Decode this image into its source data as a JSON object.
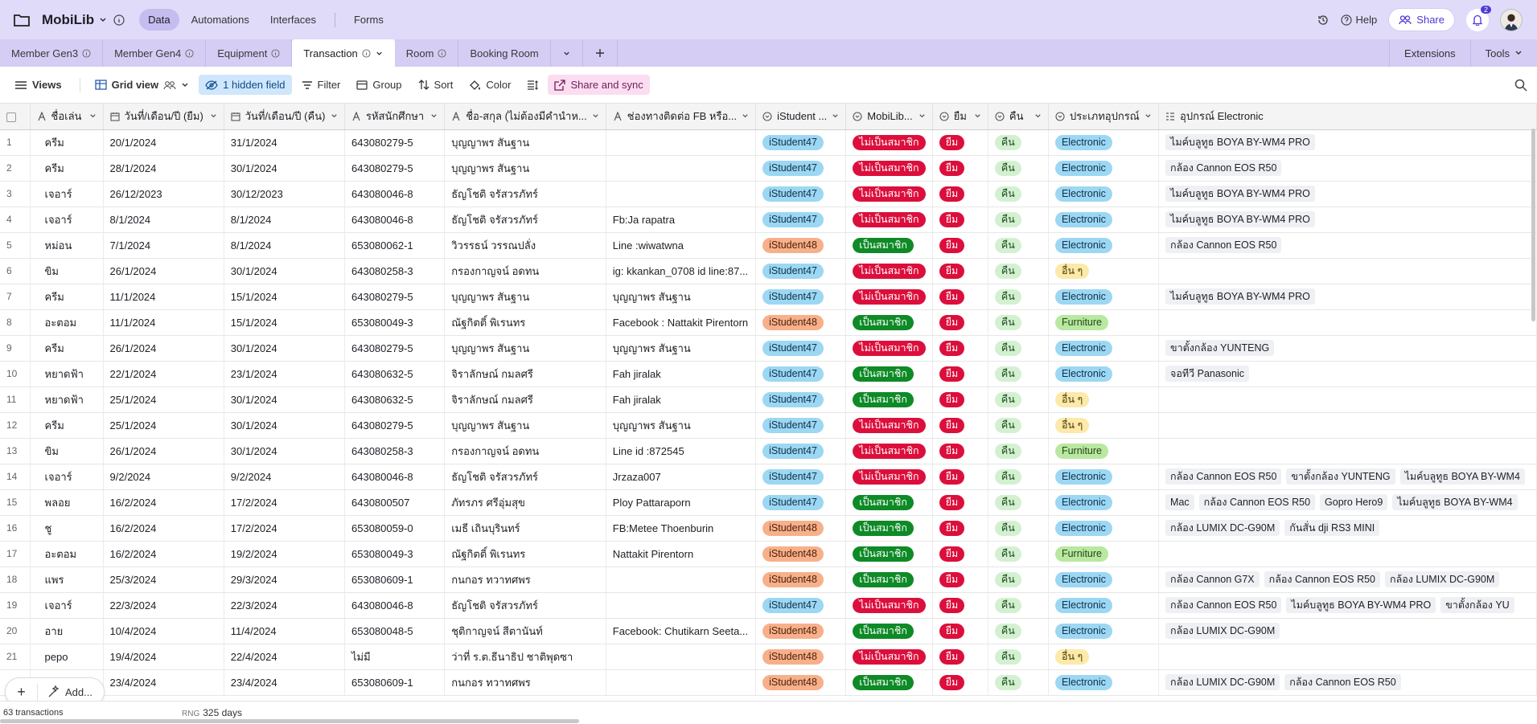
{
  "app": {
    "base_name": "MobiLib"
  },
  "nav": {
    "tabs": [
      {
        "label": "Data"
      },
      {
        "label": "Automations"
      },
      {
        "label": "Interfaces"
      },
      {
        "label": "Forms"
      }
    ]
  },
  "topright": {
    "help_label": "Help",
    "share_label": "Share",
    "notification_count": "2"
  },
  "tables": [
    {
      "label": "Member Gen3"
    },
    {
      "label": "Member Gen4"
    },
    {
      "label": "Equipment"
    },
    {
      "label": "Transaction"
    },
    {
      "label": "Room"
    },
    {
      "label": "Booking Room"
    }
  ],
  "tablebar_right": {
    "extensions": "Extensions",
    "tools": "Tools"
  },
  "toolbar": {
    "views": "Views",
    "grid_view": "Grid view",
    "hidden_field": "1 hidden field",
    "filter": "Filter",
    "group": "Group",
    "sort": "Sort",
    "color": "Color",
    "share_sync": "Share and sync"
  },
  "columns": [
    "ชื่อเล่น",
    "วันที่/เดือน/ปี (ยืม)",
    "วันที่/เดือน/ปี (คืน)",
    "รหัสนักศึกษา",
    "ชื่อ-สกุล (ไม่ต้องมีคำนำห...",
    "ช่องทางติดต่อ FB หรือ...",
    "iStudent ...",
    "MobiLib...",
    "ยืม",
    "คืน",
    "ประเภทอุปกรณ์",
    "อุปกรณ์ Electronic"
  ],
  "rows": [
    {
      "n": "1",
      "nick": "ครีม",
      "borrow": "20/1/2024",
      "ret": "31/1/2024",
      "sid": "643080279-5",
      "name": "บุญญาพร สันฐาน",
      "contact": "",
      "ist": "iStudent47",
      "mem": "ไม่เป็นสมาชิก",
      "b": "ยืม",
      "r": "คืน",
      "type": "Electronic",
      "items": [
        "ไมค์บลูทูธ BOYA BY-WM4 PRO"
      ]
    },
    {
      "n": "2",
      "nick": "ครีม",
      "borrow": "28/1/2024",
      "ret": "30/1/2024",
      "sid": "643080279-5",
      "name": "บุญญาพร สันฐาน",
      "contact": "",
      "ist": "iStudent47",
      "mem": "ไม่เป็นสมาชิก",
      "b": "ยืม",
      "r": "คืน",
      "type": "Electronic",
      "items": [
        "กล้อง Cannon EOS R50"
      ]
    },
    {
      "n": "3",
      "nick": "เจอาร์",
      "borrow": "26/12/2023",
      "ret": "30/12/2023",
      "sid": "643080046-8",
      "name": "ธัญโชติ จรัสวรภัทร์",
      "contact": "",
      "ist": "iStudent47",
      "mem": "ไม่เป็นสมาชิก",
      "b": "ยืม",
      "r": "คืน",
      "type": "Electronic",
      "items": [
        "ไมค์บลูทูธ BOYA BY-WM4 PRO"
      ]
    },
    {
      "n": "4",
      "nick": "เจอาร์",
      "borrow": "8/1/2024",
      "ret": "8/1/2024",
      "sid": "643080046-8",
      "name": "ธัญโชติ จรัสวรภัทร์",
      "contact": "Fb:Ja rapatra",
      "ist": "iStudent47",
      "mem": "ไม่เป็นสมาชิก",
      "b": "ยืม",
      "r": "คืน",
      "type": "Electronic",
      "items": [
        "ไมค์บลูทูธ BOYA BY-WM4 PRO"
      ]
    },
    {
      "n": "5",
      "nick": "หม่อน",
      "borrow": "7/1/2024",
      "ret": "8/1/2024",
      "sid": "653080062-1",
      "name": "วิวรรธน์ วรรณปลั่ง",
      "contact": "Line :wiwatwna",
      "ist": "iStudent48",
      "mem": "เป็นสมาชิก",
      "b": "ยืม",
      "r": "คืน",
      "type": "Electronic",
      "items": [
        "กล้อง Cannon EOS R50"
      ]
    },
    {
      "n": "6",
      "nick": "ขิม",
      "borrow": "26/1/2024",
      "ret": "30/1/2024",
      "sid": "643080258-3",
      "name": "กรองกาญจน์ อดทน",
      "contact": "ig: kkankan_0708 id line:87...",
      "ist": "iStudent47",
      "mem": "ไม่เป็นสมาชิก",
      "b": "ยืม",
      "r": "คืน",
      "type": "อื่น ๆ",
      "items": []
    },
    {
      "n": "7",
      "nick": "ครีม",
      "borrow": "11/1/2024",
      "ret": "15/1/2024",
      "sid": "643080279-5",
      "name": "บุญญาพร สันฐาน",
      "contact": "บุญญาพร สันฐาน",
      "ist": "iStudent47",
      "mem": "ไม่เป็นสมาชิก",
      "b": "ยืม",
      "r": "คืน",
      "type": "Electronic",
      "items": [
        "ไมค์บลูทูธ BOYA BY-WM4 PRO"
      ]
    },
    {
      "n": "8",
      "nick": "อะตอม",
      "borrow": "11/1/2024",
      "ret": "15/1/2024",
      "sid": "653080049-3",
      "name": "ณัฐกิตติ์ พิเรนทร",
      "contact": "Facebook : Nattakit Pirentorn",
      "ist": "iStudent48",
      "mem": "เป็นสมาชิก",
      "b": "ยืม",
      "r": "คืน",
      "type": "Furniture",
      "items": []
    },
    {
      "n": "9",
      "nick": "ครีม",
      "borrow": "26/1/2024",
      "ret": "30/1/2024",
      "sid": "643080279-5",
      "name": "บุญญาพร สันฐาน",
      "contact": "บุญญาพร สันฐาน",
      "ist": "iStudent47",
      "mem": "ไม่เป็นสมาชิก",
      "b": "ยืม",
      "r": "คืน",
      "type": "Electronic",
      "items": [
        "ขาตั้งกล้อง YUNTENG"
      ]
    },
    {
      "n": "10",
      "nick": "หยาดฟ้า",
      "borrow": "22/1/2024",
      "ret": "23/1/2024",
      "sid": "643080632-5",
      "name": "จิราลักษณ์ กมลศรี",
      "contact": "Fah jiralak",
      "ist": "iStudent47",
      "mem": "เป็นสมาชิก",
      "b": "ยืม",
      "r": "คืน",
      "type": "Electronic",
      "items": [
        "จอทีวี Panasonic"
      ]
    },
    {
      "n": "11",
      "nick": "หยาดฟ้า",
      "borrow": "25/1/2024",
      "ret": "30/1/2024",
      "sid": "643080632-5",
      "name": "จิราลักษณ์ กมลศรี",
      "contact": "Fah jiralak",
      "ist": "iStudent47",
      "mem": "เป็นสมาชิก",
      "b": "ยืม",
      "r": "คืน",
      "type": "อื่น ๆ",
      "items": []
    },
    {
      "n": "12",
      "nick": "ครีม",
      "borrow": "25/1/2024",
      "ret": "30/1/2024",
      "sid": "643080279-5",
      "name": "บุญญาพร สันฐาน",
      "contact": "บุญญาพร สันฐาน",
      "ist": "iStudent47",
      "mem": "ไม่เป็นสมาชิก",
      "b": "ยืม",
      "r": "คืน",
      "type": "อื่น ๆ",
      "items": []
    },
    {
      "n": "13",
      "nick": "ขิม",
      "borrow": "26/1/2024",
      "ret": "30/1/2024",
      "sid": "643080258-3",
      "name": "กรองกาญจน์ อดทน",
      "contact": "Line id :872545",
      "ist": "iStudent47",
      "mem": "ไม่เป็นสมาชิก",
      "b": "ยืม",
      "r": "คืน",
      "type": "Furniture",
      "items": []
    },
    {
      "n": "14",
      "nick": "เจอาร์",
      "borrow": "9/2/2024",
      "ret": "9/2/2024",
      "sid": "643080046-8",
      "name": "ธัญโชติ จรัสวรภัทร์",
      "contact": "Jrzaza007",
      "ist": "iStudent47",
      "mem": "ไม่เป็นสมาชิก",
      "b": "ยืม",
      "r": "คืน",
      "type": "Electronic",
      "items": [
        "กล้อง Cannon EOS R50",
        "ขาตั้งกล้อง YUNTENG",
        "ไมค์บลูทูธ BOYA BY-WM4"
      ]
    },
    {
      "n": "15",
      "nick": "พลอย",
      "borrow": "16/2/2024",
      "ret": "17/2/2024",
      "sid": "6430800507",
      "name": "ภัทรภร ศรีอุ่มสุข",
      "contact": "Ploy Pattaraporn",
      "ist": "iStudent47",
      "mem": "เป็นสมาชิก",
      "b": "ยืม",
      "r": "คืน",
      "type": "Electronic",
      "items": [
        "Mac",
        "กล้อง Cannon EOS R50",
        "Gopro Hero9",
        "ไมค์บลูทูธ BOYA BY-WM4"
      ]
    },
    {
      "n": "16",
      "nick": "ชู",
      "borrow": "16/2/2024",
      "ret": "17/2/2024",
      "sid": "653080059-0",
      "name": "เมธี เถินบุรินทร์",
      "contact": "FB:Metee Thoenburin",
      "ist": "iStudent48",
      "mem": "เป็นสมาชิก",
      "b": "ยืม",
      "r": "คืน",
      "type": "Electronic",
      "items": [
        "กล้อง LUMIX DC-G90M",
        "กันสั่น dji RS3 MINI"
      ]
    },
    {
      "n": "17",
      "nick": "อะตอม",
      "borrow": "16/2/2024",
      "ret": "19/2/2024",
      "sid": "653080049-3",
      "name": "ณัฐกิตติ์ พิเรนทร",
      "contact": "Nattakit Pirentorn",
      "ist": "iStudent48",
      "mem": "เป็นสมาชิก",
      "b": "ยืม",
      "r": "คืน",
      "type": "Furniture",
      "items": []
    },
    {
      "n": "18",
      "nick": "แพร",
      "borrow": "25/3/2024",
      "ret": "29/3/2024",
      "sid": "653080609-1",
      "name": "กนกอร ทวาทศพร",
      "contact": "",
      "ist": "iStudent48",
      "mem": "เป็นสมาชิก",
      "b": "ยืม",
      "r": "คืน",
      "type": "Electronic",
      "items": [
        "กล้อง Cannon G7X",
        "กล้อง Cannon EOS R50",
        "กล้อง LUMIX DC-G90M"
      ]
    },
    {
      "n": "19",
      "nick": "เจอาร์",
      "borrow": "22/3/2024",
      "ret": "22/3/2024",
      "sid": "643080046-8",
      "name": "ธัญโชติ จรัสวรภัทร์",
      "contact": "",
      "ist": "iStudent47",
      "mem": "ไม่เป็นสมาชิก",
      "b": "ยืม",
      "r": "คืน",
      "type": "Electronic",
      "items": [
        "กล้อง Cannon EOS R50",
        "ไมค์บลูทูธ BOYA BY-WM4 PRO",
        "ขาตั้งกล้อง YU"
      ]
    },
    {
      "n": "20",
      "nick": "อาย",
      "borrow": "10/4/2024",
      "ret": "11/4/2024",
      "sid": "653080048-5",
      "name": "ชุติกาญจน์ สีตานันท์",
      "contact": "Facebook: Chutikarn Seeta...",
      "ist": "iStudent48",
      "mem": "เป็นสมาชิก",
      "b": "ยืม",
      "r": "คืน",
      "type": "Electronic",
      "items": [
        "กล้อง LUMIX DC-G90M"
      ]
    },
    {
      "n": "21",
      "nick": "pepo",
      "borrow": "19/4/2024",
      "ret": "22/4/2024",
      "sid": "ไม่มี",
      "name": "ว่าที่ ร.ต.ธีนาธิป ชาติพุดซา",
      "contact": "",
      "ist": "iStudent48",
      "mem": "ไม่เป็นสมาชิก",
      "b": "ยืม",
      "r": "คืน",
      "type": "อื่น ๆ",
      "items": []
    },
    {
      "n": "",
      "nick": "",
      "borrow": "23/4/2024",
      "ret": "23/4/2024",
      "sid": "653080609-1",
      "name": "กนกอร ทวาทศพร",
      "contact": "",
      "ist": "iStudent48",
      "mem": "เป็นสมาชิก",
      "b": "ยืม",
      "r": "คืน",
      "type": "Electronic",
      "items": [
        "กล้อง LUMIX DC-G90M",
        "กล้อง Cannon EOS R50"
      ]
    }
  ],
  "footer": {
    "count": "63 transactions",
    "rng_label": "RNG",
    "rng_value": "325 days",
    "add_label": "Add..."
  },
  "colors": {
    "topbar": "#e1dbfa",
    "tablebar": "#d5cdf4",
    "accent": "#4c3ad6"
  }
}
